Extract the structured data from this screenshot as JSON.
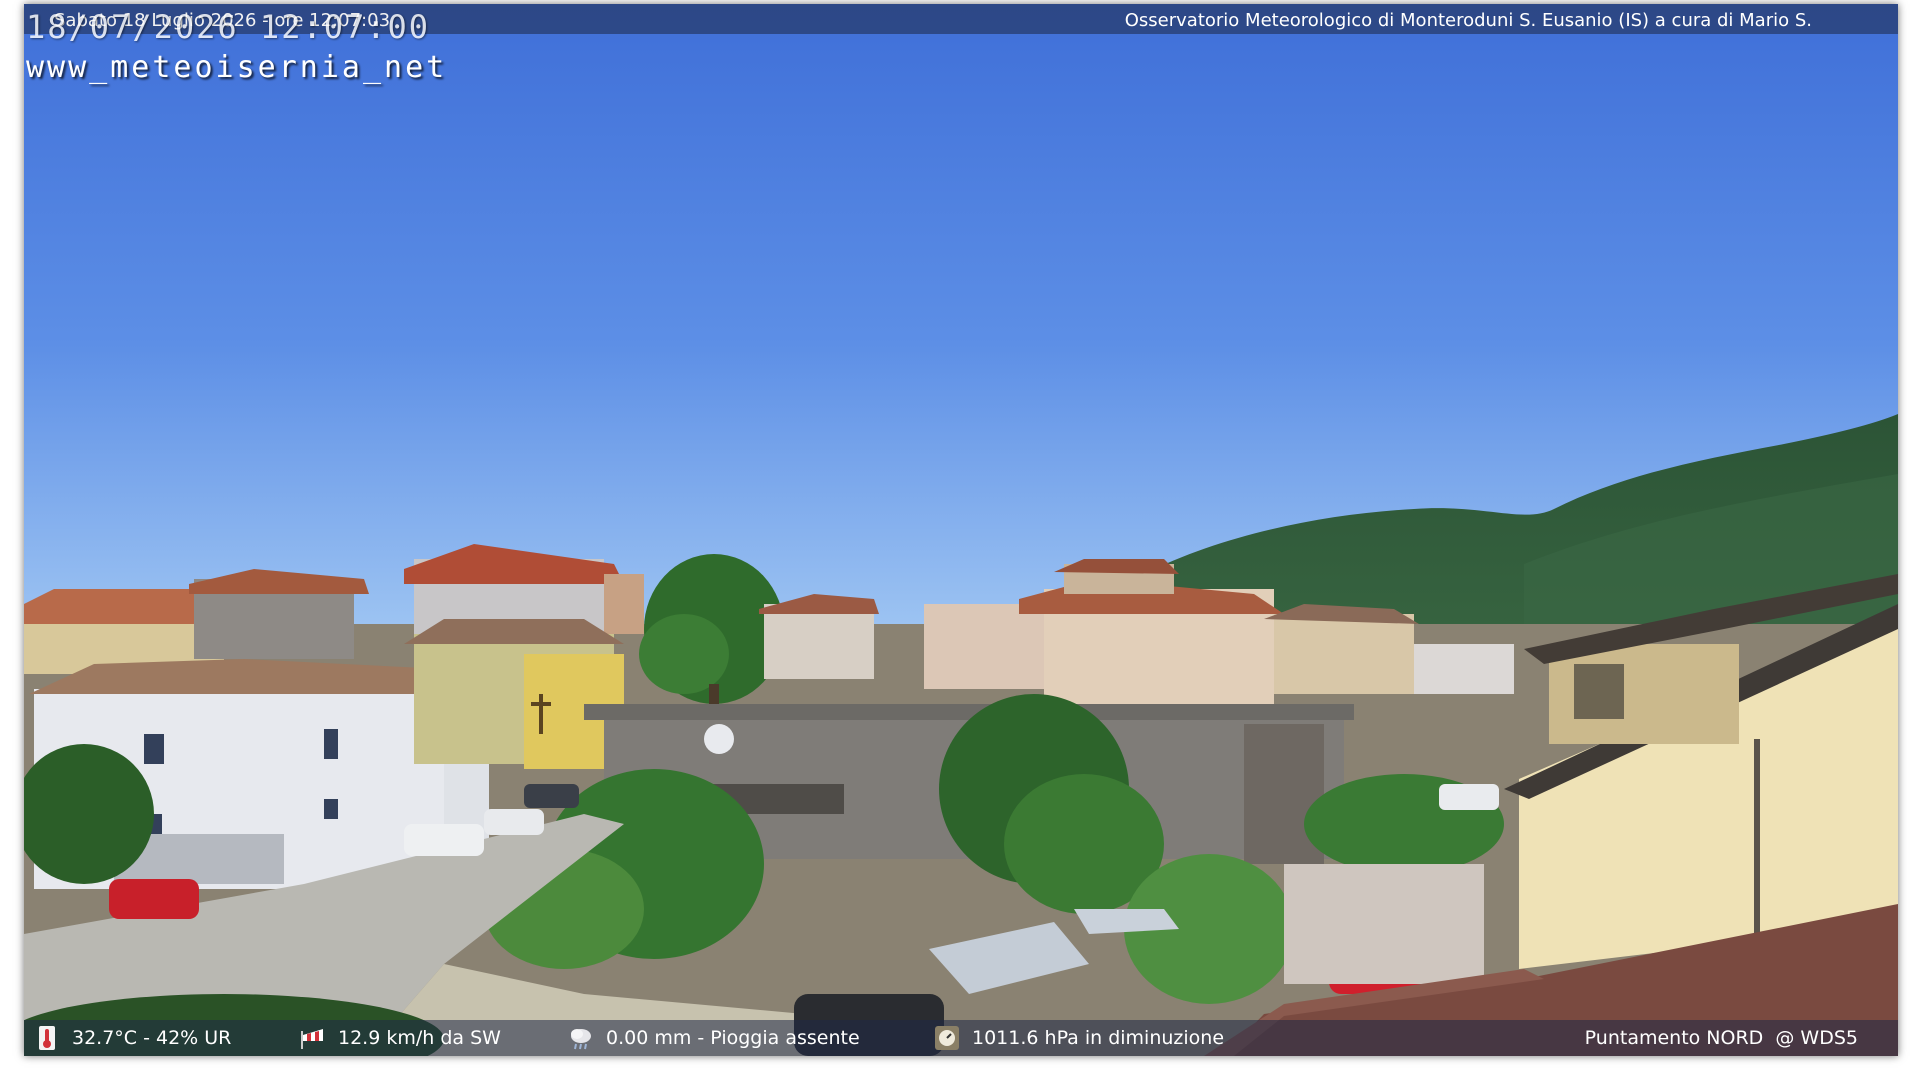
{
  "header": {
    "date_line": "Sabato 18 Luglio 2026 - ore 12:07:03",
    "observatory": "Osservatorio Meteorologico di Monteroduni S. Eusanio (IS) a cura di Mario S."
  },
  "overlay": {
    "timestamp": "18/07/2026 12:07:00",
    "site": "www_meteoisernia_net"
  },
  "footer": {
    "temperature": "32.7°C - 42% UR",
    "wind": "12.9 km/h da SW",
    "rain": "0.00 mm - Pioggia assente",
    "pressure": "1011.6 hPa in diminuzione",
    "pointing": "Puntamento NORD  @ WDS5"
  },
  "icons": {
    "temperature": "thermometer-icon",
    "wind": "windsock-icon",
    "rain": "rain-cloud-icon",
    "pressure": "barometer-icon"
  },
  "colors": {
    "sky_top": "#3d6fd6",
    "sky_bottom": "#86b4f0",
    "mountain": "#2f5a3a",
    "tree": "#2f6e2f",
    "roof": "#b0553a"
  }
}
